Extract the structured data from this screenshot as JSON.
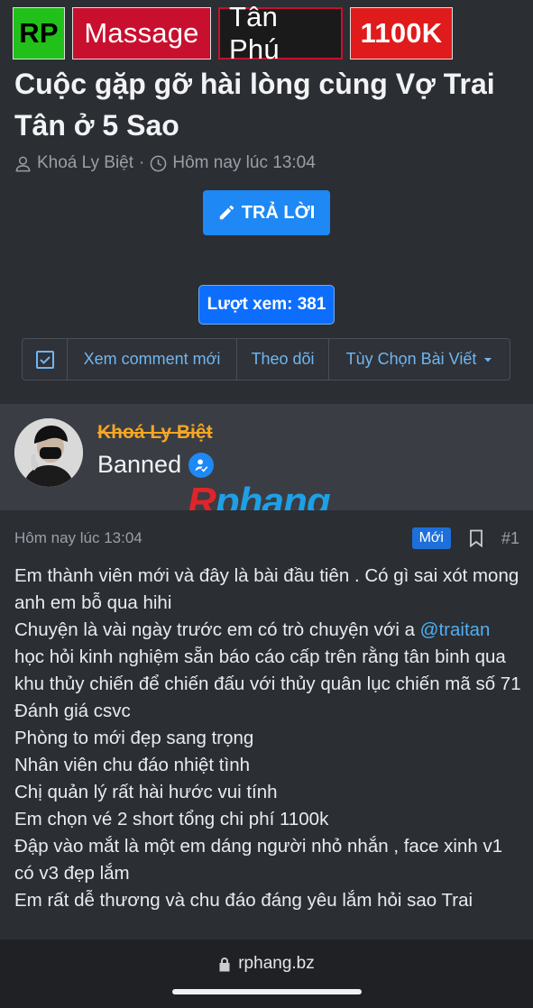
{
  "tags": {
    "rp": "RP",
    "category": "Massage",
    "district": "Tân Phú",
    "price": "1100K"
  },
  "thread": {
    "title": "Cuộc gặp gỡ hài lòng cùng Vợ Trai Tân ở 5 Sao",
    "author": "Khoá Ly Biệt",
    "separator": "·",
    "time": "Hôm nay lúc 13:04",
    "reply_label": "TRẢ LỜI",
    "views_label": "Lượt xem: 381"
  },
  "actionbar": {
    "new_comments": "Xem comment mới",
    "follow": "Theo dõi",
    "options": "Tùy Chọn Bài Viết"
  },
  "post": {
    "username": "Khoá Ly Biệt",
    "role": "Banned",
    "watermark_a": "R",
    "watermark_b": "phang",
    "time": "Hôm nay lúc 13:04",
    "badge": "Mới",
    "number": "#1",
    "lines": {
      "l1": "Em thành viên mới và đây là bài đầu tiên . Có gì sai xót mong anh em bỗ qua hihi",
      "l2a": "Chuyện là vài ngày trước em có trò chuyện với a ",
      "mention": "@traitan",
      "l2b": " học hỏi kinh nghiệm sẵn báo cáo cấp trên rằng tân binh qua khu thủy chiến để chiến đấu với thủy quân lục chiến mã số 71",
      "l3": "Đánh giá csvc",
      "l4": "Phòng to mới đẹp sang trọng",
      "l5": "Nhân viên chu đáo nhiệt tình",
      "l6": "Chị quản lý rất hài hước vui tính",
      "l7": "Em chọn vé 2 short tổng chi phí 1100k",
      "l8": "Đập vào mắt là một em dáng người nhỏ nhắn , face xinh v1 có v3 đẹp lắm",
      "l9": "Em rất dễ thương và chu đáo đáng yêu lắm hỏi sao Trai"
    }
  },
  "browser": {
    "url": "rphang.bz"
  },
  "colors": {
    "background": "#2b2e33",
    "accent": "#1e88f5",
    "link": "#6fb6f2",
    "username": "#f5a623"
  },
  "icons": [
    "user-icon",
    "clock-icon",
    "pencil-icon",
    "checkbox-icon",
    "caret-down-icon",
    "verified-icon",
    "bookmark-icon",
    "lock-icon"
  ]
}
